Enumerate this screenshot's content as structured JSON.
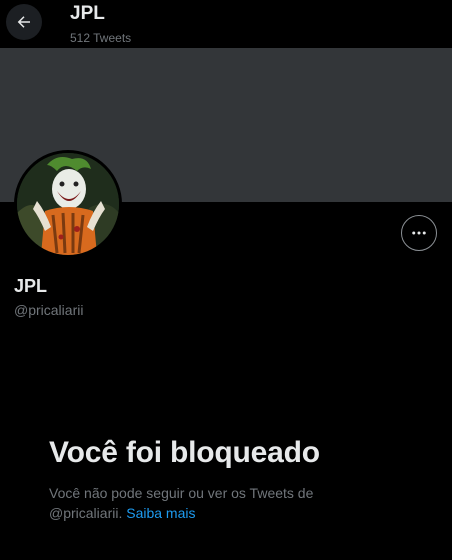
{
  "header": {
    "back_icon": "arrow-left-icon",
    "title": "JPL",
    "tweet_count": "512 Tweets"
  },
  "profile": {
    "display_name": "JPL",
    "handle": "@pricaliarii",
    "avatar_icon": "avatar-joker",
    "more_icon": "more-horizontal-icon"
  },
  "blocked": {
    "title": "Você foi bloqueado",
    "message_line1": "Você não pode seguir ou ver os Tweets de",
    "message_line2": "@pricaliarii.",
    "link": "Saiba mais"
  },
  "colors": {
    "background": "#000000",
    "banner": "#333639",
    "text": "#e7e9ea",
    "muted": "#71767b",
    "link": "#1d9bf0"
  }
}
